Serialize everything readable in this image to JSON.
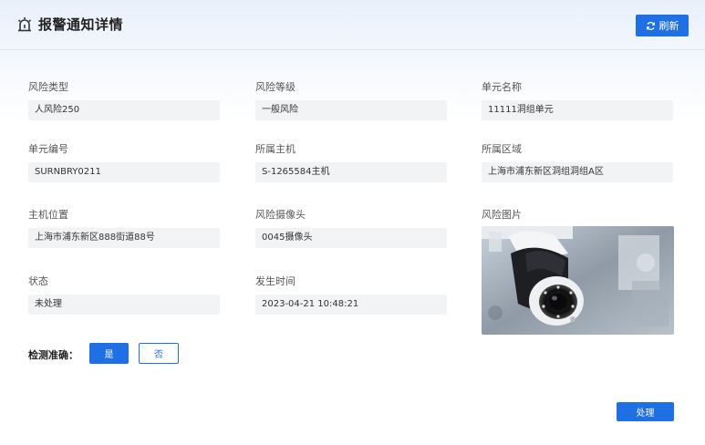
{
  "header": {
    "title": "报警通知详情",
    "refresh_label": "刷新"
  },
  "fields": {
    "risk_type": {
      "label": "风险类型",
      "value": "人风险250"
    },
    "risk_level": {
      "label": "风险等级",
      "value": "一般风险"
    },
    "unit_name": {
      "label": "单元名称",
      "value": "11111洞组单元"
    },
    "unit_code": {
      "label": "单元编号",
      "value": "SURNBRY0211"
    },
    "host": {
      "label": "所属主机",
      "value": "S-1265584主机"
    },
    "area": {
      "label": "所属区域",
      "value": "上海市浦东新区洞组洞组A区"
    },
    "host_location": {
      "label": "主机位置",
      "value": "上海市浦东新区888街道88号"
    },
    "camera": {
      "label": "风险摄像头",
      "value": "0045摄像头"
    },
    "photo": {
      "label": "风险图片"
    },
    "status": {
      "label": "状态",
      "value": "未处理"
    },
    "time": {
      "label": "发生时间",
      "value": "2023-04-21 10:48:21"
    }
  },
  "check": {
    "label": "检测准确：",
    "yes_label": "是",
    "no_label": "否"
  },
  "actions": {
    "process_label": "处理"
  },
  "colors": {
    "primary": "#1f6fe5",
    "field_bg": "#f2f3f5"
  }
}
